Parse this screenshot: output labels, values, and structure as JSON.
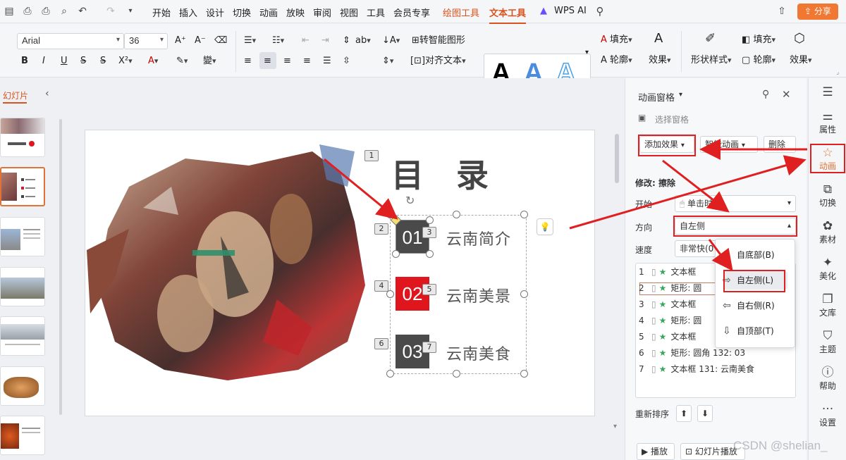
{
  "menubar": {
    "items": [
      "开始",
      "插入",
      "设计",
      "切换",
      "动画",
      "放映",
      "审阅",
      "视图",
      "工具",
      "会员专享"
    ],
    "drawing_tools": "绘图工具",
    "text_tools": "文本工具",
    "wps_ai": "WPS AI",
    "share": "分享"
  },
  "ribbon": {
    "font_family": "Arial",
    "font_size": "36",
    "smart_shape": "转智能图形",
    "align_text": "对齐文本",
    "fill": "填充",
    "outline": "轮廓",
    "effect": "效果",
    "shape_style": "形状样式",
    "fill2": "填充",
    "outline2": "轮廓",
    "effect2": "效果",
    "wordart_letters": [
      "A",
      "A",
      "A"
    ]
  },
  "thumbs": {
    "title": "幻灯片"
  },
  "slide": {
    "title": "目　录",
    "items": [
      {
        "num": "01",
        "label": "云南简介",
        "color": "#4a4a4a"
      },
      {
        "num": "02",
        "label": "云南美景",
        "color": "#e0161e"
      },
      {
        "num": "03",
        "label": "云南美食",
        "color": "#4a4a4a"
      }
    ],
    "markers": [
      "1",
      "2",
      "3",
      "4",
      "5",
      "6",
      "7"
    ]
  },
  "anim_pane": {
    "title": "动画窗格",
    "select_pane": "选择窗格",
    "add_effect": "添加效果",
    "smart_anim": "智能动画",
    "delete": "删除",
    "modify": "修改: 擦除",
    "start_label": "开始",
    "start_value": "单击时",
    "direction_label": "方向",
    "direction_value": "自左侧",
    "speed_label": "速度",
    "speed_value": "非常快(0",
    "list": [
      {
        "n": "1",
        "text": "文本框"
      },
      {
        "n": "2",
        "text": "矩形: 圆"
      },
      {
        "n": "3",
        "text": "文本框"
      },
      {
        "n": "4",
        "text": "矩形: 圆"
      },
      {
        "n": "5",
        "text": "文本框"
      },
      {
        "n": "6",
        "text": "矩形: 圆角 132: 03"
      },
      {
        "n": "7",
        "text": "文本框 131: 云南美食"
      }
    ],
    "reorder": "重新排序",
    "play": "播放",
    "slideshow": "幻灯片播放",
    "dropdown": [
      "自底部(B)",
      "自左侧(L)",
      "自右侧(R)",
      "自顶部(T)"
    ]
  },
  "side_bar": [
    "属性",
    "动画",
    "切换",
    "素材",
    "美化",
    "文库",
    "主题",
    "帮助",
    "设置"
  ],
  "watermark": "CSDN @shelian_"
}
